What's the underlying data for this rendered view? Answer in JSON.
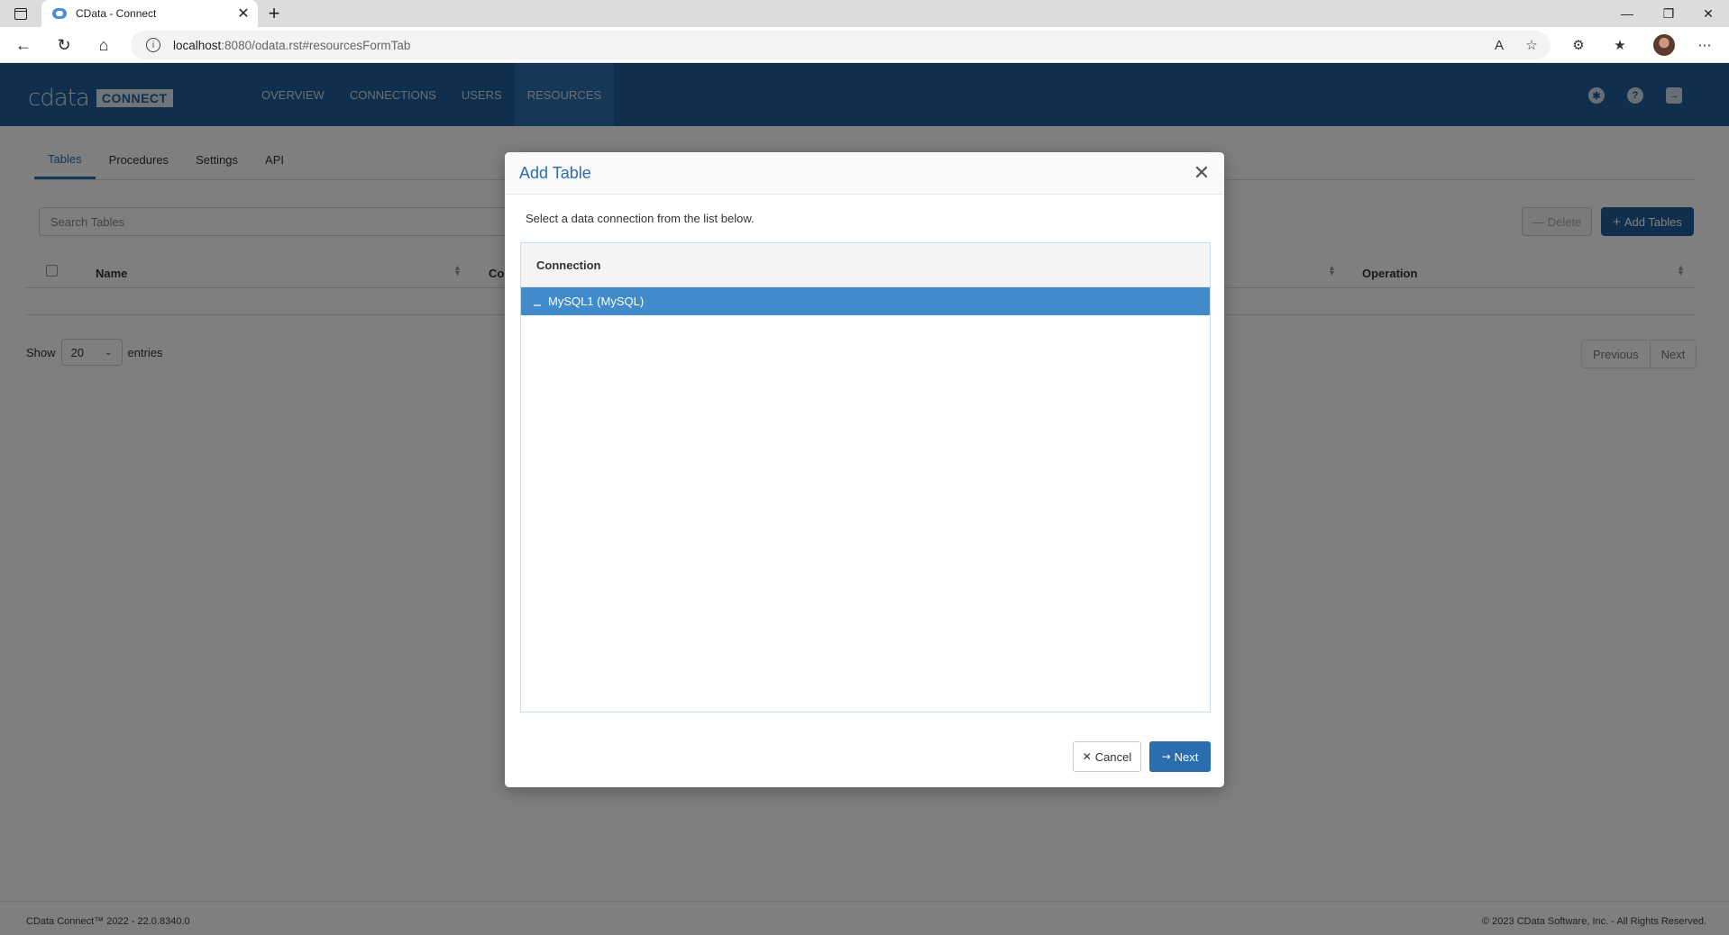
{
  "browser": {
    "tab_title": "CData - Connect",
    "url_host": "localhost",
    "url_path": ":8080/odata.rst#resourcesFormTab"
  },
  "app": {
    "logo_word": "cdata",
    "logo_badge": "CONNECT",
    "nav": [
      "OVERVIEW",
      "CONNECTIONS",
      "USERS",
      "RESOURCES"
    ],
    "subtabs": [
      "Tables",
      "Procedures",
      "Settings",
      "API"
    ],
    "search_placeholder": "Search Tables",
    "delete_label": "Delete",
    "add_tables_label": "Add Tables",
    "columns": [
      "Name",
      "Co",
      "Operation"
    ],
    "show_label": "Show",
    "entries_value": "20",
    "entries_label": "entries",
    "previous_label": "Previous",
    "next_label": "Next"
  },
  "footer": {
    "left": "CData Connect™ 2022 - 22.0.8340.0",
    "right": "© 2023 CData Software, Inc. - All Rights Reserved."
  },
  "modal": {
    "title": "Add Table",
    "description": "Select a data connection from the list below.",
    "list_header": "Connection",
    "connections": [
      "MySQL1 (MySQL)"
    ],
    "cancel_label": "Cancel",
    "next_label": "Next"
  },
  "colors": {
    "header": "#1f5e9a",
    "accent": "#2a6eb0",
    "selected_row": "#428bca"
  }
}
